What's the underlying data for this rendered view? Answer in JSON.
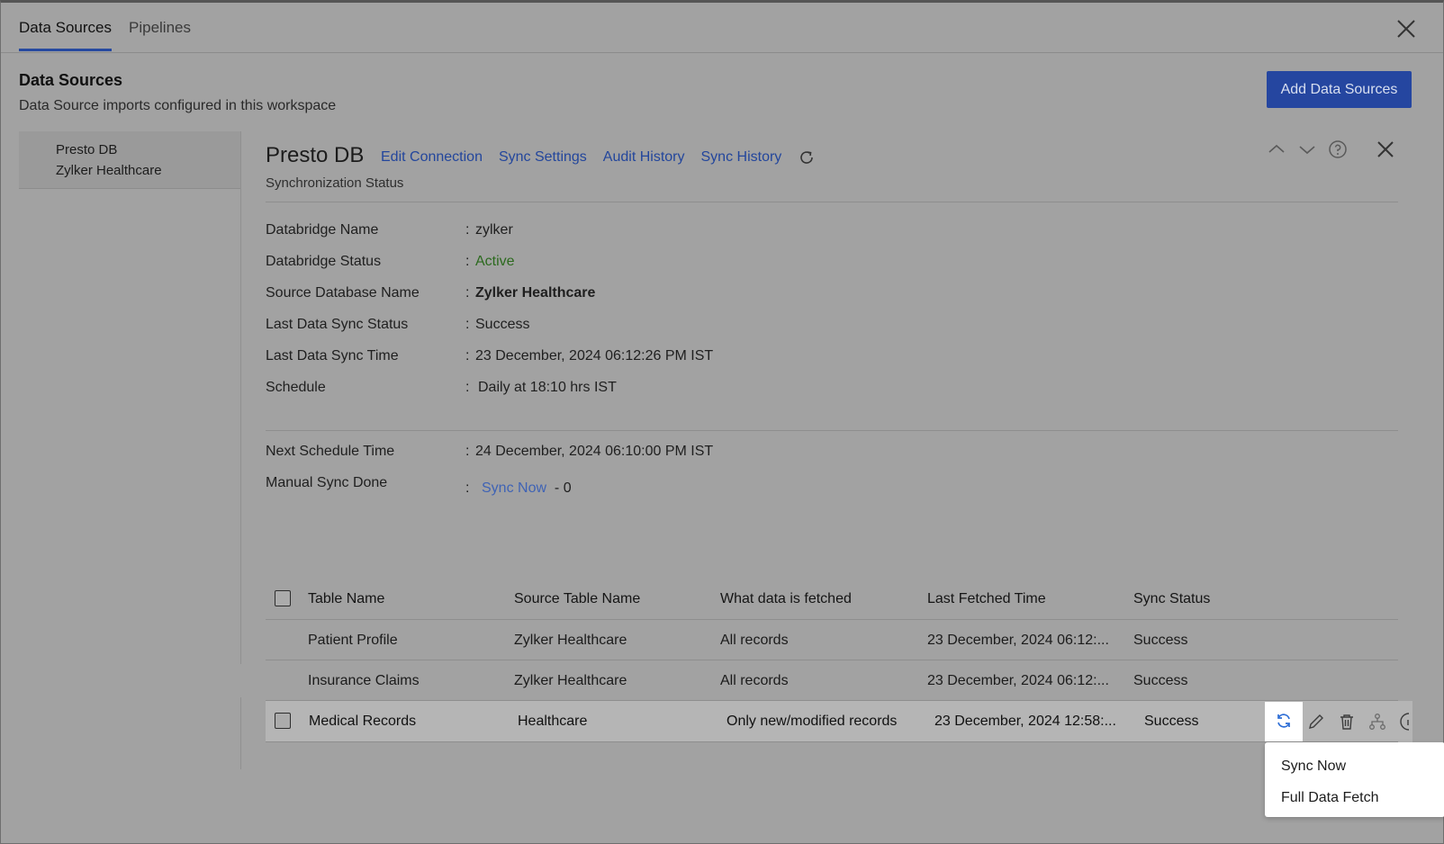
{
  "tabs": [
    {
      "label": "Data Sources",
      "active": true
    },
    {
      "label": "Pipelines",
      "active": false
    }
  ],
  "page": {
    "title": "Data Sources",
    "subtitle": "Data Source imports configured in this workspace",
    "add_button": "Add Data Sources"
  },
  "sidebar": {
    "items": [
      {
        "name": "Presto DB",
        "subname": "Zylker Healthcare"
      }
    ]
  },
  "detail": {
    "title": "Presto DB",
    "links": {
      "edit": "Edit Connection",
      "settings": "Sync Settings",
      "audit": "Audit History",
      "history": "Sync History"
    },
    "subtitle": "Synchronization Status",
    "info": [
      {
        "label": "Databridge Name",
        "value": "zylker"
      },
      {
        "label": "Databridge Status",
        "value": "Active"
      },
      {
        "label": "Source Database Name",
        "value": "Zylker Healthcare"
      },
      {
        "label": "Last Data Sync Status",
        "value": "Success"
      },
      {
        "label": "Last Data Sync Time",
        "value": "23 December, 2024 06:12:26 PM IST"
      },
      {
        "label": "Schedule",
        "value": "Daily at 18:10 hrs IST"
      }
    ],
    "next_schedule": {
      "label": "Next Schedule Time",
      "value": "24 December, 2024 06:10:00 PM IST"
    },
    "manual_sync": {
      "label": "Manual Sync Done",
      "link": "Sync Now",
      "count": "- 0"
    },
    "colon": ":"
  },
  "table": {
    "headers": [
      "Table Name",
      "Source Table Name",
      "What data is fetched",
      "Last Fetched Time",
      "Sync Status"
    ],
    "rows": [
      [
        "Patient Profile",
        "Zylker Healthcare",
        "All records",
        "23 December, 2024 06:12:...",
        "Success"
      ],
      [
        "Insurance Claims",
        "Zylker Healthcare",
        "All records",
        "23 December, 2024 06:12:...",
        "Success"
      ],
      [
        "Medical Records",
        "Healthcare",
        "Only new/modified records",
        "23 December, 2024 12:58:...",
        "Success"
      ]
    ]
  },
  "dropdown": {
    "items": [
      "Sync Now",
      "Full Data Fetch"
    ]
  },
  "colors": {
    "accent": "#2546a0",
    "link": "#23469c",
    "active_status": "#2c6a1e"
  }
}
